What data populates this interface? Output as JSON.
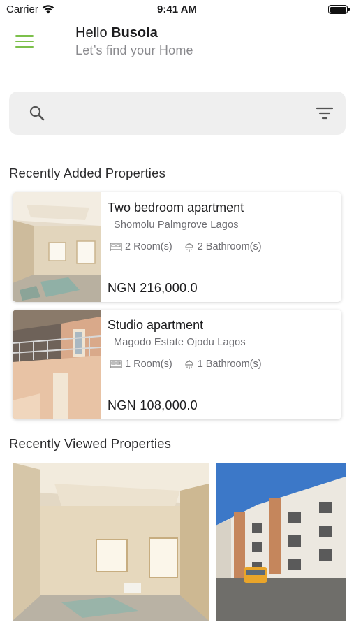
{
  "status_bar": {
    "carrier": "Carrier",
    "time": "9:41 AM"
  },
  "header": {
    "greeting_prefix": "Hello",
    "user_name": "Busola",
    "subtitle": "Let’s find your Home"
  },
  "search": {
    "value": "",
    "placeholder": ""
  },
  "recently_added": {
    "title": "Recently Added Properties",
    "items": [
      {
        "title": "Two bedroom apartment",
        "location": "Shomolu Palmgrove Lagos",
        "rooms": "2 Room(s)",
        "bathrooms": "2 Bathroom(s)",
        "price": "NGN 216,000.0"
      },
      {
        "title": "Studio apartment",
        "location": "Magodo Estate Ojodu Lagos",
        "rooms": "1 Room(s)",
        "bathrooms": "1 Bathroom(s)",
        "price": "NGN 108,000.0"
      }
    ]
  },
  "recently_viewed": {
    "title": "Recently Viewed Properties"
  },
  "colors": {
    "accent": "#7cc04b",
    "search_bg": "#efefef",
    "muted_text": "#6e6e73"
  },
  "icons": [
    "wifi-icon",
    "battery-icon",
    "menu-icon",
    "search-icon",
    "filter-icon",
    "bed-icon",
    "shower-icon"
  ]
}
